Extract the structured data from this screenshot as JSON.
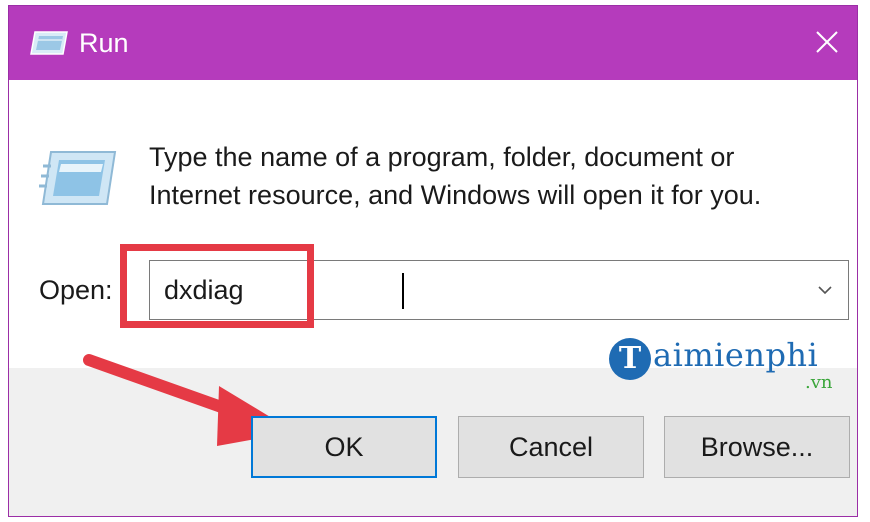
{
  "window": {
    "title": "Run",
    "close_glyph": "✕"
  },
  "content": {
    "description_line1": "Type the name of a program, folder, document or",
    "description_line2": "Internet resource, and Windows will open it for you.",
    "open_label": "Open:",
    "open_value": "dxdiag"
  },
  "buttons": {
    "ok": "OK",
    "cancel": "Cancel",
    "browse": "Browse..."
  },
  "watermark": {
    "letter": "T",
    "text": "aimienphi",
    "suffix": ".vn"
  },
  "colors": {
    "titlebar": "#b53bbc",
    "highlight": "#e53a45",
    "accent": "#0078d7",
    "watermark_blue": "#1f6bb3",
    "watermark_green": "#3aa53a"
  },
  "icons": {
    "title_icon": "run-app-icon",
    "content_icon": "run-app-icon",
    "close_icon": "close-icon",
    "dropdown_icon": "chevron-down-icon"
  }
}
